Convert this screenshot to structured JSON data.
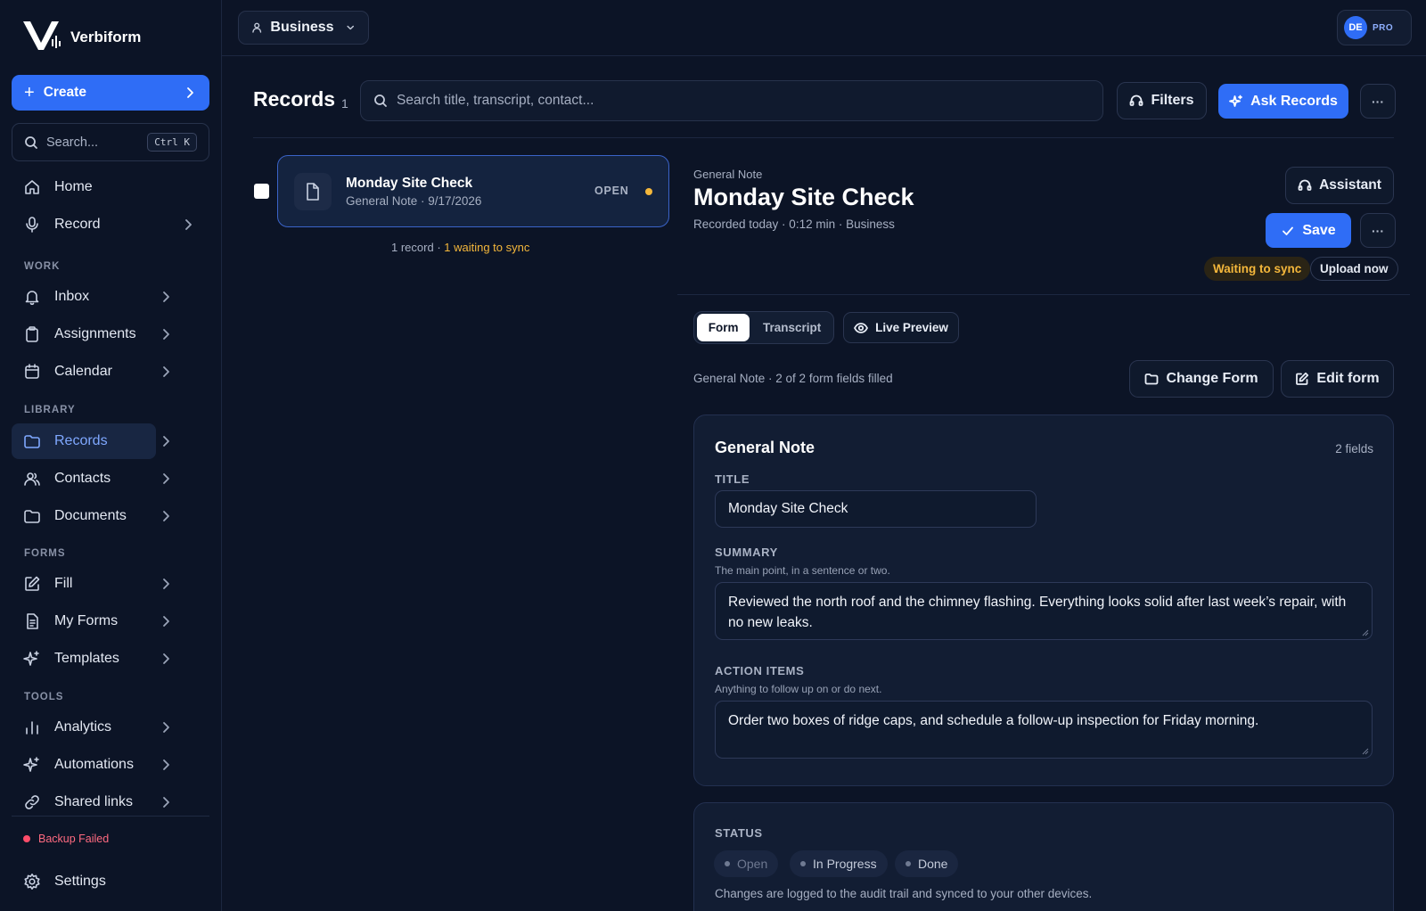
{
  "app": {
    "name": "Verbiform",
    "workspace": "Business",
    "account_initials": "DE",
    "plan": "PRO",
    "accent": "#2f6df6"
  },
  "sidebar": {
    "create_label": "Create",
    "search_placeholder": "Search...",
    "search_shortcut": "Ctrl K",
    "top_items": [
      {
        "label": "Home",
        "icon": "home-icon"
      },
      {
        "label": "Record",
        "icon": "microphone-icon"
      }
    ],
    "sections": [
      {
        "title": "WORK",
        "items": [
          {
            "label": "Inbox",
            "icon": "bell-icon"
          },
          {
            "label": "Assignments",
            "icon": "clipboard-icon"
          },
          {
            "label": "Calendar",
            "icon": "calendar-icon"
          }
        ]
      },
      {
        "title": "LIBRARY",
        "items": [
          {
            "label": "Records",
            "icon": "folder-icon",
            "active": true
          },
          {
            "label": "Contacts",
            "icon": "users-icon"
          },
          {
            "label": "Documents",
            "icon": "folder-icon"
          }
        ]
      },
      {
        "title": "FORMS",
        "items": [
          {
            "label": "Fill",
            "icon": "edit-icon"
          },
          {
            "label": "My Forms",
            "icon": "file-text-icon"
          },
          {
            "label": "Templates",
            "icon": "sparkle-icon"
          }
        ]
      },
      {
        "title": "TOOLS",
        "items": [
          {
            "label": "Analytics",
            "icon": "bar-chart-icon"
          },
          {
            "label": "Automations",
            "icon": "sparkle-icon"
          },
          {
            "label": "Shared links",
            "icon": "link-icon"
          }
        ]
      }
    ],
    "backup_status": "Backup Failed",
    "backup_color": "#ff4d6a",
    "settings_label": "Settings"
  },
  "records": {
    "title": "Records",
    "count": "1",
    "search_placeholder": "Search title, transcript, contact...",
    "filters_label": "Filters",
    "ask_label": "Ask Records",
    "more_label": "···",
    "list": [
      {
        "title": "Monday Site Check",
        "subtitle": "General Note · 9/17/2026",
        "status": "OPEN",
        "sync_color": "#f4b73b"
      }
    ],
    "footer_count": "1 record",
    "footer_sep": " · ",
    "footer_waiting": "1 waiting to sync"
  },
  "detail": {
    "kicker": "General Note",
    "title": "Monday Site Check",
    "meta": "Recorded today · 0:12 min · Business",
    "assistant_label": "Assistant",
    "save_label": "Save",
    "more_label": "···",
    "sync_status": "Waiting to sync",
    "upload_label": "Upload now",
    "tabs": [
      "Form",
      "Transcript"
    ],
    "live_preview_label": "Live Preview",
    "form_info": "General Note · 2 of 2 form fields filled",
    "change_form_label": "Change Form",
    "edit_form_label": "Edit form",
    "form": {
      "name": "General Note",
      "field_count": "2 fields",
      "title_label": "TITLE",
      "title_value": "Monday Site Check",
      "summary_label": "SUMMARY",
      "summary_help": "The main point, in a sentence or two.",
      "summary_value": "Reviewed the north roof and the chimney flashing. Everything looks solid after last week’s repair, with no new leaks.",
      "actions_label": "ACTION ITEMS",
      "actions_help": "Anything to follow up on or do next.",
      "actions_value": "Order two boxes of ridge caps, and schedule a follow-up inspection for Friday morning."
    },
    "status": {
      "label": "STATUS",
      "options": [
        "Open",
        "In Progress",
        "Done"
      ],
      "note": "Changes are logged to the audit trail and synced to your other devices."
    }
  }
}
